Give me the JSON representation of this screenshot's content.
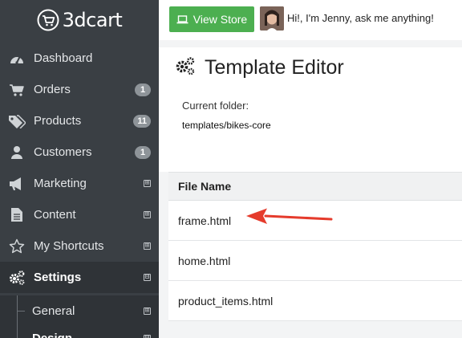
{
  "brand": {
    "logo_text": "3dcart"
  },
  "sidebar": {
    "items": [
      {
        "label": "Dashboard",
        "icon": "dashboard-icon"
      },
      {
        "label": "Orders",
        "icon": "cart-icon",
        "badge": "1"
      },
      {
        "label": "Products",
        "icon": "tags-icon",
        "badge": "11"
      },
      {
        "label": "Customers",
        "icon": "user-icon",
        "badge": "1"
      },
      {
        "label": "Marketing",
        "icon": "megaphone-icon",
        "expand": "⊞"
      },
      {
        "label": "Content",
        "icon": "document-icon",
        "expand": "⊞"
      },
      {
        "label": "My Shortcuts",
        "icon": "star-icon",
        "expand": "⊞"
      },
      {
        "label": "Settings",
        "icon": "gears-icon",
        "expand": "⊟"
      }
    ],
    "subitems": [
      {
        "label": "General",
        "expand": "⊞"
      },
      {
        "label": "Design",
        "expand": "⊟"
      }
    ]
  },
  "topbar": {
    "view_store_label": "View Store",
    "chat_text": "Hi!, I'm Jenny, ask me anything!"
  },
  "page": {
    "title": "Template Editor",
    "current_folder_label": "Current folder:",
    "current_folder_path": "templates/bikes-core"
  },
  "table": {
    "header": "File Name",
    "rows": [
      "frame.html",
      "home.html",
      "product_items.html"
    ]
  },
  "colors": {
    "sidebar_bg": "#3a3f44",
    "accent_green": "#4caf50",
    "arrow_red": "#e53b2c"
  }
}
